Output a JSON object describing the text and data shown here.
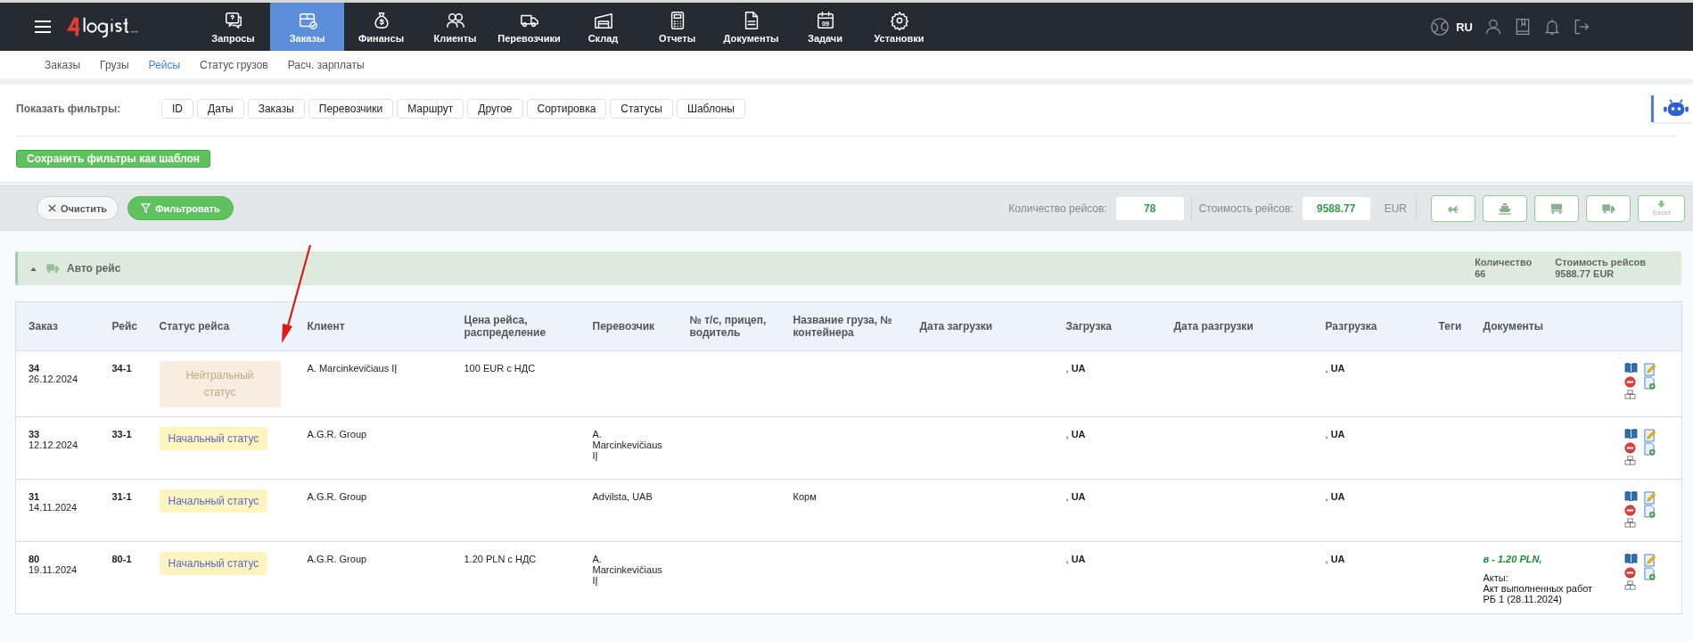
{
  "nav": {
    "items": [
      {
        "label": "Запросы",
        "selected": false
      },
      {
        "label": "Заказы",
        "selected": true
      },
      {
        "label": "Финансы",
        "selected": false
      },
      {
        "label": "Клиенты",
        "selected": false
      },
      {
        "label": "Перевозчики",
        "selected": false
      },
      {
        "label": "Склад",
        "selected": false
      },
      {
        "label": "Отчеты",
        "selected": false
      },
      {
        "label": "Документы",
        "selected": false
      },
      {
        "label": "Задачи",
        "selected": false,
        "day": "09"
      },
      {
        "label": "Установки",
        "selected": false
      }
    ],
    "language": "RU"
  },
  "subnav": [
    {
      "label": "Заказы",
      "selected": false
    },
    {
      "label": "Грузы",
      "selected": false
    },
    {
      "label": "Рейсы",
      "selected": true
    },
    {
      "label": "Статус грузов",
      "selected": false
    },
    {
      "label": "Расч. зарплаты",
      "selected": false
    }
  ],
  "filters": {
    "label": "Показать фильтры:",
    "buttons": [
      "ID",
      "Даты",
      "Заказы",
      "Перевозчики",
      "Маршрут",
      "Другое",
      "Сортировка",
      "Статусы",
      "Шаблоны"
    ],
    "save_button": "Сохранить фильтры как шаблон"
  },
  "toolbar": {
    "clear_button": "Очистить",
    "filter_button": "Фильтровать",
    "count_label": "Количество рейсов:",
    "count": "78",
    "cost_label": "Стоимость рейсов:",
    "cost": "9588.77",
    "currency": "EUR",
    "excel_label": "Excel"
  },
  "group": {
    "title": "Авто рейс",
    "expanded": true,
    "count_label": "Количество",
    "count": "66",
    "cost_label": "Стоимость рейсов",
    "cost": "9588.77 EUR"
  },
  "table": {
    "columns": [
      "Заказ",
      "Рейс",
      "Статус рейса",
      "Клиент",
      "Цена рейса, распределение",
      "Перевозчик",
      "№ т/с, прицеп, водитель",
      "Название груза, № контейнера",
      "Дата загрузки",
      "Загрузка",
      "Дата разгрузки",
      "Разгрузка",
      "Теги",
      "Документы"
    ],
    "rows": [
      {
        "order": "34",
        "date": "26.12.2024",
        "trip": "34-1",
        "status": {
          "label": "Нейтральный статус",
          "kind": "neutral"
        },
        "client": "A. Marcinkevičiaus IĮ",
        "price": "100 EUR с НДС",
        "loading": ", **UA**",
        "unloading": ", **UA**"
      },
      {
        "order": "33",
        "date": "12.12.2024",
        "trip": "33-1",
        "status": {
          "label": "Начальный статус",
          "kind": "initial"
        },
        "client": "A.G.R. Group",
        "carrier": "A. Marcinkevičiaus IĮ",
        "loading": ", **UA**",
        "unloading": ", **UA**"
      },
      {
        "order": "31",
        "date": "14.11.2024",
        "trip": "31-1",
        "status": {
          "label": "Начальный статус",
          "kind": "initial"
        },
        "client": "A.G.R. Group",
        "carrier": "Advilsta, UAB",
        "cargo": "Корм",
        "loading": ", **UA**",
        "unloading": ", **UA**"
      },
      {
        "order": "80",
        "date": "19.11.2024",
        "trip": "80-1",
        "status": {
          "label": "Начальный статус",
          "kind": "initial"
        },
        "client": "A.G.R. Group",
        "price": "1.20 PLN с НДС",
        "carrier": "A. Marcinkevičiaus IĮ",
        "loading": ", **UA**",
        "unloading": ", **UA**",
        "documents": {
          "payment": "в - 1.20 PLN,",
          "acts_label": "Акты:",
          "act": "Акт выполненных работ РБ 1 (28.11.2024)"
        }
      }
    ]
  }
}
